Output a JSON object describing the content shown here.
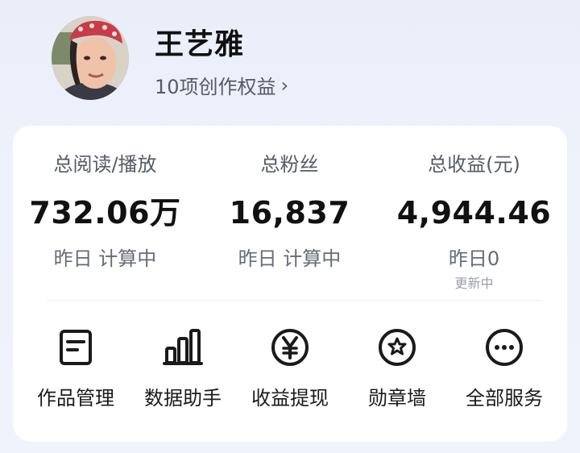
{
  "profile": {
    "name": "王艺雅",
    "rights_link": "10项创作权益",
    "chevron": "›"
  },
  "stats": [
    {
      "label": "总阅读/播放",
      "value": "732.06万",
      "sub": "昨日 计算中",
      "note": ""
    },
    {
      "label": "总粉丝",
      "value": "16,837",
      "sub": "昨日 计算中",
      "note": ""
    },
    {
      "label": "总收益(元)",
      "value": "4,944.46",
      "sub": "昨日0",
      "note": "更新中"
    }
  ],
  "tools": [
    {
      "label": "作品管理",
      "icon": "document-icon"
    },
    {
      "label": "数据助手",
      "icon": "bar-chart-icon"
    },
    {
      "label": "收益提现",
      "icon": "yen-circle-icon"
    },
    {
      "label": "勋章墙",
      "icon": "medal-star-icon"
    },
    {
      "label": "全部服务",
      "icon": "more-circle-icon"
    }
  ],
  "colors": {
    "background": "#eef2fb",
    "card": "#ffffff",
    "primary_text": "#111111",
    "secondary_text": "#555b66"
  }
}
